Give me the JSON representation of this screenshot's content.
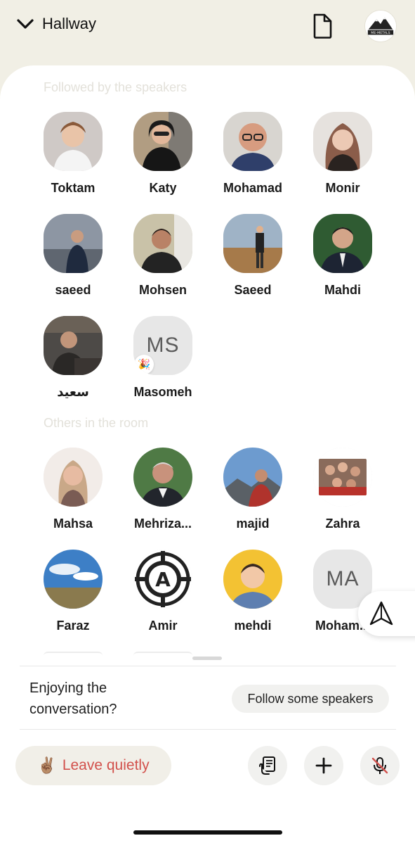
{
  "header": {
    "room_name": "Hallway",
    "icons": [
      "chevron-down-icon",
      "document-icon",
      "profile-logo"
    ],
    "logo_text": "ME-METALS"
  },
  "sections": {
    "followed_title": "Followed by the speakers",
    "others_title": "Others in the room"
  },
  "followed": [
    {
      "name": "Toktam"
    },
    {
      "name": "Katy"
    },
    {
      "name": "Mohamad"
    },
    {
      "name": "Monir"
    },
    {
      "name": "saeed"
    },
    {
      "name": "Mohsen"
    },
    {
      "name": "Saeed"
    },
    {
      "name": "Mahdi"
    },
    {
      "name": "سعید"
    },
    {
      "name": "Masomeh",
      "initials": "MS",
      "badge": "🎉"
    }
  ],
  "others": [
    {
      "name": "Mahsa"
    },
    {
      "name": "Mehriza..."
    },
    {
      "name": "majid"
    },
    {
      "name": "Zahra"
    },
    {
      "name": "Faraz"
    },
    {
      "name": "Amir",
      "logo_letter": "A"
    },
    {
      "name": "mehdi"
    },
    {
      "name": "Moham...",
      "initials": "MA"
    }
  ],
  "footer": {
    "enjoy_text": "Enjoying the conversation?",
    "follow_button": "Follow some speakers",
    "leave_emoji": "✌🏽",
    "leave_label": "Leave quietly"
  },
  "colors": {
    "background": "#f1efe5",
    "sheet": "#ffffff",
    "leave_red": "#d2514c",
    "section_title": "#e3e1da"
  }
}
